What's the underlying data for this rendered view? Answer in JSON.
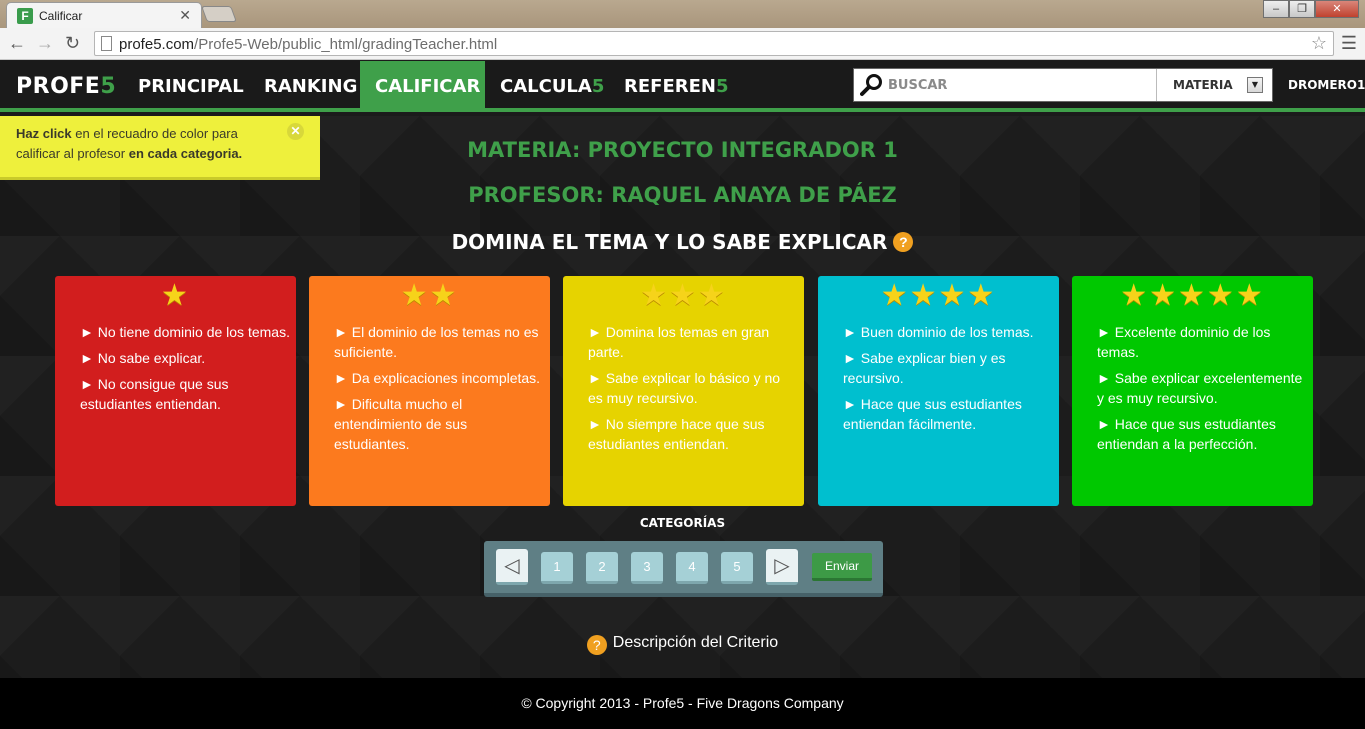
{
  "browser": {
    "tab_title": "Calificar",
    "tab_favicon": "F",
    "url_host": "profe5.com",
    "url_path": "/Profe5-Web/public_html/gradingTeacher.html"
  },
  "nav": {
    "logo_main": "PROFE",
    "logo_five": "5",
    "items": [
      {
        "label": "PRINCIPAL",
        "suffix": ""
      },
      {
        "label": "RANKING",
        "suffix": ""
      },
      {
        "label": "CALIFICAR",
        "suffix": "",
        "active": true
      },
      {
        "label": "CALCULA",
        "suffix": "5"
      },
      {
        "label": "REFEREN",
        "suffix": "5"
      }
    ],
    "search_placeholder": "BUSCAR",
    "materia_label": "MATERIA",
    "user": "DROMERO1"
  },
  "tip": {
    "bold1": "Haz click",
    "text1": " en el recuadro de color para calificar al profesor ",
    "bold2": "en cada categoria."
  },
  "heading": {
    "materia": "MATERIA: PROYECTO INTEGRADOR 1",
    "profesor": "PROFESOR: RAQUEL ANAYA DE PÁEZ",
    "category": "DOMINA EL TEMA Y LO SABE EXPLICAR"
  },
  "cards": [
    {
      "stars": 1,
      "color": "#d21e1e",
      "items": [
        "No tiene dominio de los temas.",
        "No sabe explicar.",
        "No consigue que sus estudiantes entiendan."
      ]
    },
    {
      "stars": 2,
      "color": "#fc7a1e",
      "items": [
        "El dominio de los temas no es suficiente.",
        "Da explicaciones incompletas.",
        "Dificulta mucho el entendimiento de sus estudiantes."
      ]
    },
    {
      "stars": 3,
      "color": "#e6d300",
      "items": [
        "Domina los temas en gran parte.",
        "Sabe explicar lo básico y no es muy recursivo.",
        "No siempre hace que sus estudiantes entiendan."
      ]
    },
    {
      "stars": 4,
      "color": "#00bfcf",
      "items": [
        "Buen dominio de los temas.",
        "Sabe explicar bien y es recursivo.",
        "Hace que sus estudiantes entiendan fácilmente."
      ]
    },
    {
      "stars": 5,
      "color": "#00c800",
      "items": [
        "Excelente dominio de los temas.",
        "Sabe explicar excelentemente y es muy recursivo.",
        "Hace que sus estudiantes entiendan a la perfección."
      ]
    }
  ],
  "pager": {
    "label": "CATEGORÍAS",
    "pages": [
      "1",
      "2",
      "3",
      "4",
      "5"
    ],
    "send": "Enviar"
  },
  "criterio": "Descripción del Criterio",
  "footer": "© Copyright 2013 - Profe5 - Five Dragons Company",
  "colors": {
    "brand_green": "#3fa04a",
    "tip_yellow": "#eef03c"
  }
}
